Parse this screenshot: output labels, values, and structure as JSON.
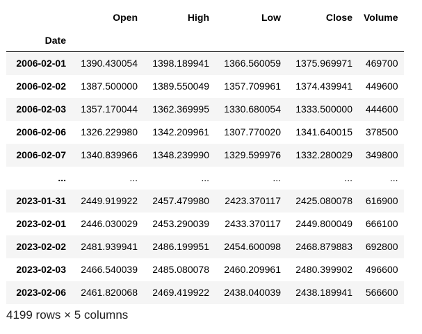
{
  "dataframe": {
    "columns": [
      "Open",
      "High",
      "Low",
      "Close",
      "Volume"
    ],
    "index_name": "Date",
    "rows": [
      {
        "date": "2006-02-01",
        "values": [
          "1390.430054",
          "1398.189941",
          "1366.560059",
          "1375.969971",
          "469700"
        ]
      },
      {
        "date": "2006-02-02",
        "values": [
          "1387.500000",
          "1389.550049",
          "1357.709961",
          "1374.439941",
          "449600"
        ]
      },
      {
        "date": "2006-02-03",
        "values": [
          "1357.170044",
          "1362.369995",
          "1330.680054",
          "1333.500000",
          "444600"
        ]
      },
      {
        "date": "2006-02-06",
        "values": [
          "1326.229980",
          "1342.209961",
          "1307.770020",
          "1341.640015",
          "378500"
        ]
      },
      {
        "date": "2006-02-07",
        "values": [
          "1340.839966",
          "1348.239990",
          "1329.599976",
          "1332.280029",
          "349800"
        ]
      },
      {
        "date": "...",
        "values": [
          "...",
          "...",
          "...",
          "...",
          "..."
        ]
      },
      {
        "date": "2023-01-31",
        "values": [
          "2449.919922",
          "2457.479980",
          "2423.370117",
          "2425.080078",
          "616900"
        ]
      },
      {
        "date": "2023-02-01",
        "values": [
          "2446.030029",
          "2453.290039",
          "2433.370117",
          "2449.800049",
          "666100"
        ]
      },
      {
        "date": "2023-02-02",
        "values": [
          "2481.939941",
          "2486.199951",
          "2454.600098",
          "2468.879883",
          "692800"
        ]
      },
      {
        "date": "2023-02-03",
        "values": [
          "2466.540039",
          "2485.080078",
          "2460.209961",
          "2480.399902",
          "496600"
        ]
      },
      {
        "date": "2023-02-06",
        "values": [
          "2461.820068",
          "2469.419922",
          "2438.040039",
          "2438.189941",
          "566600"
        ]
      }
    ],
    "shape_text": "4199 rows × 5 columns"
  }
}
